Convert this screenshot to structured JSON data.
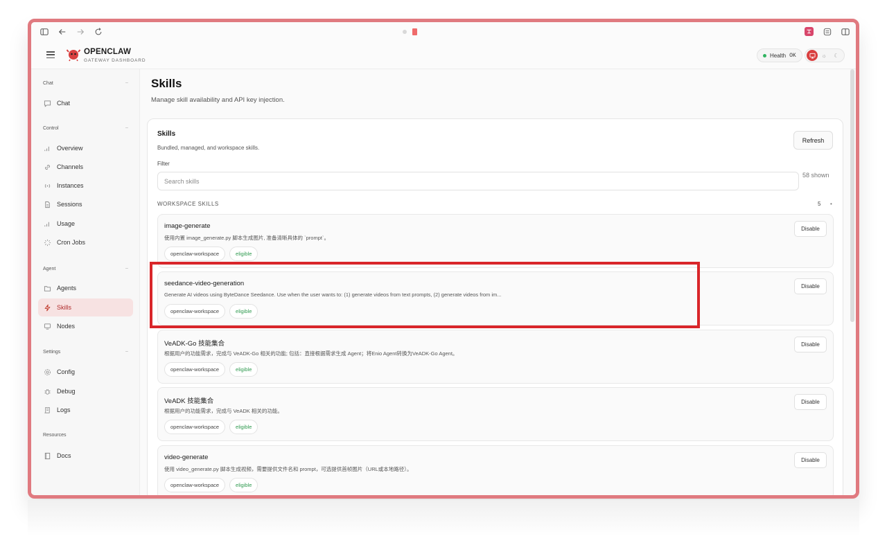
{
  "browser": {
    "icons": [
      "sidebar-toggle-icon",
      "back-arrow-icon",
      "forward-arrow-icon",
      "reload-icon",
      "extension-icon",
      "tab-list-icon",
      "split-view-icon"
    ]
  },
  "topbar": {
    "brand_title": "OPENCLAW",
    "brand_subtitle": "GATEWAY DASHBOARD",
    "health_label": "Health",
    "health_value": "OK",
    "theme_icons": [
      "monitor-icon",
      "sun-icon",
      "moon-icon"
    ]
  },
  "sidebar": {
    "sections": [
      {
        "title": "Chat",
        "items": [
          {
            "label": "Chat",
            "icon": "chat-bubble-icon"
          }
        ]
      },
      {
        "title": "Control",
        "items": [
          {
            "label": "Overview",
            "icon": "bar-chart-icon"
          },
          {
            "label": "Channels",
            "icon": "link-icon"
          },
          {
            "label": "Instances",
            "icon": "broadcast-icon"
          },
          {
            "label": "Sessions",
            "icon": "document-icon"
          },
          {
            "label": "Usage",
            "icon": "bar-chart-icon"
          },
          {
            "label": "Cron Jobs",
            "icon": "loader-icon"
          }
        ]
      },
      {
        "title": "Agent",
        "items": [
          {
            "label": "Agents",
            "icon": "folder-icon"
          },
          {
            "label": "Skills",
            "icon": "lightning-icon"
          },
          {
            "label": "Nodes",
            "icon": "monitor-icon"
          }
        ]
      },
      {
        "title": "Settings",
        "items": [
          {
            "label": "Config",
            "icon": "gear-icon"
          },
          {
            "label": "Debug",
            "icon": "bug-icon"
          },
          {
            "label": "Logs",
            "icon": "scroll-icon"
          }
        ]
      },
      {
        "title": "Resources",
        "items": [
          {
            "label": "Docs",
            "icon": "book-icon"
          }
        ]
      }
    ],
    "active_item": "Skills"
  },
  "main": {
    "title": "Skills",
    "subtitle": "Manage skill availability and API key injection."
  },
  "card": {
    "title": "Skills",
    "subtitle": "Bundled, managed, and workspace skills.",
    "refresh_label": "Refresh",
    "filter_label": "Filter",
    "search_placeholder": "Search skills",
    "shown_text": "58 shown",
    "group_label": "WORKSPACE SKILLS",
    "group_count": "5",
    "group_dot": "•"
  },
  "skills": [
    {
      "name": "image-generate",
      "desc": "使用内置 image_generate.py 脚本生成图片, 准备清晰具体的 `prompt`。",
      "tags": [
        "openclaw-workspace",
        "eligible"
      ],
      "action": "Disable"
    },
    {
      "name": "seedance-video-generation",
      "desc": "Generate AI videos using ByteDance Seedance. Use when the user wants to: (1) generate videos from text prompts, (2) generate videos from im...",
      "tags": [
        "openclaw-workspace",
        "eligible"
      ],
      "action": "Disable"
    },
    {
      "name": "VeADK-Go 技能集合",
      "desc": "根据用户的功能需求，完成与 VeADK-Go 相关的功能; 包括：直接根据需求生成 Agent；将Enio Agent转换为VeADK-Go Agent。",
      "tags": [
        "openclaw-workspace",
        "eligible"
      ],
      "action": "Disable"
    },
    {
      "name": "VeADK 技能集合",
      "desc": "根据用户的功能需求，完成与 VeADK 相关的功能。",
      "tags": [
        "openclaw-workspace",
        "eligible"
      ],
      "action": "Disable"
    },
    {
      "name": "video-generate",
      "desc": "使用 video_generate.py 脚本生成视频，需要提供文件名和 prompt，可选提供首帧图片（URL或本地路径）。",
      "tags": [
        "openclaw-workspace",
        "eligible"
      ],
      "action": "Disable"
    }
  ],
  "colors": {
    "accent": "#d93f3f",
    "frame": "#e07a80",
    "highlight": "#d9262a",
    "eligible": "#2f9a4f",
    "health_dot": "#2fb360"
  }
}
